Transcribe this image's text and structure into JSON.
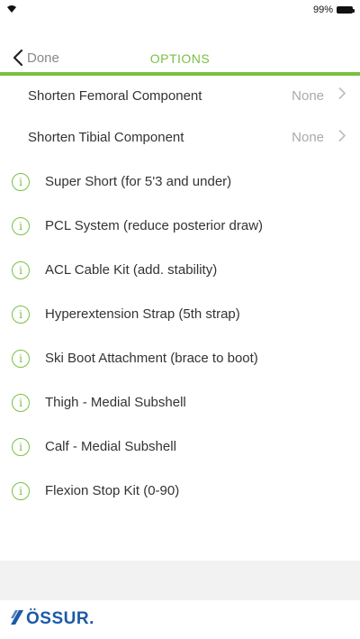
{
  "status_bar": {
    "battery_text": "99%"
  },
  "nav": {
    "back_label": "Done",
    "title": "OPTIONS"
  },
  "rows_disclosure": [
    {
      "label": "Shorten Femoral Component",
      "value": "None"
    },
    {
      "label": "Shorten Tibial Component",
      "value": "None"
    }
  ],
  "rows_info": [
    {
      "label": "Super Short (for 5'3 and under)"
    },
    {
      "label": "PCL System (reduce posterior draw)"
    },
    {
      "label": "ACL Cable Kit (add. stability)"
    },
    {
      "label": "Hyperextension Strap (5th strap)"
    },
    {
      "label": "Ski Boot Attachment (brace to boot)"
    },
    {
      "label": "Thigh - Medial Subshell"
    },
    {
      "label": "Calf - Medial Subshell"
    },
    {
      "label": "Flexion Stop Kit (0-90)"
    }
  ],
  "info_icon_glyph": "i",
  "footer": {
    "logo_text": "ÖSSUR."
  },
  "colors": {
    "accent": "#7ac143",
    "brand_blue": "#1b5aa6",
    "value_gray": "#aaaaaa"
  },
  "icons": [
    "wifi-icon",
    "battery-icon",
    "chevron-left-icon",
    "chevron-right-icon",
    "info-icon",
    "ossur-logo-icon"
  ]
}
